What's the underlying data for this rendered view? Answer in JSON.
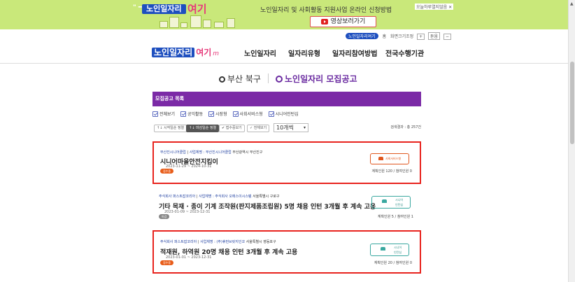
{
  "banner": {
    "logo_text": "노인일자리",
    "logo_suffix": "여기",
    "headline": "노인일자리 및 사회활동 지원사업 온라인 신청방법",
    "video_button": "영상보러가기",
    "close_today": "오늘하루열지않음 ✕"
  },
  "util": {
    "pill": "노인일자리여기",
    "links": [
      "홈",
      "화면크기조정",
      "+",
      "돋움",
      "−"
    ]
  },
  "nav": {
    "brand_a": "노인일자리",
    "brand_b": "여기",
    "brand_c": "m",
    "menu": [
      "노인일자리",
      "일자리유형",
      "일자리참여방법",
      "전국수행기관"
    ]
  },
  "page_title": {
    "region": "부산 북구",
    "section": "노인일자리 모집공고"
  },
  "list": {
    "header": "모집공고 목록",
    "filters": [
      "전체보기",
      "공익활동",
      "시장형",
      "사회서비스형",
      "시니어인턴십"
    ],
    "sort_buttons": [
      "↑↓ 시작일순 정렬",
      "↑↓ 마감일순 정렬",
      "✔ 접수중보기",
      "✓ 전체보기"
    ],
    "page_size": "10개씩",
    "result_count": "검색결과 : 총 257건"
  },
  "cards": [
    {
      "meta_org": "부산진시니어클럽",
      "meta_operator": "사업체명 : 부산진시니어클럽",
      "meta_region": "부산광역시 부산진구",
      "title": "시니어마을안전지킴이",
      "date": "2023-11-29 ~ 2024-10-31",
      "status": "접수중",
      "type": "사회서비스형",
      "quota": "계획인원 120 / 참여인원 0"
    },
    {
      "meta_org": "주식회사 퍼스트잡코리아",
      "meta_operator": "사업체명 : 주식회사 오에스이시스템",
      "meta_region": "서울특별시 구로구",
      "title": "기타 목재 · 종이 기계 조작원(판지제품조립원) 5명 채용 인턴 3개월 후 계속 고용",
      "date": "2023-01-09 ~ 2023-12-31",
      "status": "마감",
      "type_line1": "시니어",
      "type_line2": "인턴십",
      "quota": "계획인원 5 / 참여인원 1"
    },
    {
      "meta_org": "주식회사 퍼스트잡코리아",
      "meta_operator": "사업체명 : (주)휴먼브릿지인코",
      "meta_region": "서울특별시 영등포구",
      "title": "적재원, 하역원 20명 채용 인턴 3개월 후 계속 고용",
      "date": "2023-01-01 ~ 2023-12-31",
      "status": "접수중",
      "type_line1": "시니어",
      "type_line2": "인턴십",
      "quota": "계획인원 20 / 참여인원 0"
    }
  ],
  "colors": {
    "banner_bg": "#c9e87a",
    "brand_blue": "#1e4fbf",
    "brand_pink": "#e63a7a",
    "list_header": "#7b2aa6",
    "highlight": "#e8231e",
    "status_hiring": "#e85d1a"
  }
}
